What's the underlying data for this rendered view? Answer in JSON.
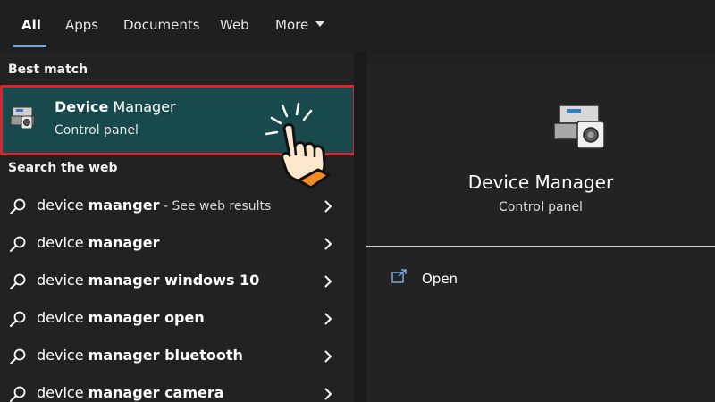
{
  "tabs": [
    {
      "label": "All",
      "active": true
    },
    {
      "label": "Apps"
    },
    {
      "label": "Documents"
    },
    {
      "label": "Web"
    },
    {
      "label": "More"
    }
  ],
  "best_match": {
    "section_label": "Best match",
    "title_bold": "Device",
    "title_rest": " Manager",
    "subtitle": "Control panel",
    "icon": "device-manager-icon"
  },
  "search_web": {
    "section_label": "Search the web",
    "results": [
      {
        "prefix": "device ",
        "bold": "maanger",
        "suffix": " - See web results"
      },
      {
        "prefix": "device ",
        "bold": "manager",
        "suffix": ""
      },
      {
        "prefix": "device ",
        "bold": "manager windows 10",
        "suffix": ""
      },
      {
        "prefix": "device ",
        "bold": "manager open",
        "suffix": ""
      },
      {
        "prefix": "device ",
        "bold": "manager bluetooth",
        "suffix": ""
      },
      {
        "prefix": "device ",
        "bold": "manager camera",
        "suffix": ""
      }
    ]
  },
  "detail": {
    "title": "Device Manager",
    "subtitle": "Control panel",
    "actions": [
      {
        "label": "Open",
        "icon": "open-external-icon"
      }
    ]
  },
  "colors": {
    "accent_underline": "#7aa6d6",
    "highlight_bg": "#17494d",
    "highlight_border": "#d3262e",
    "hand_cuff": "#f08a24"
  }
}
